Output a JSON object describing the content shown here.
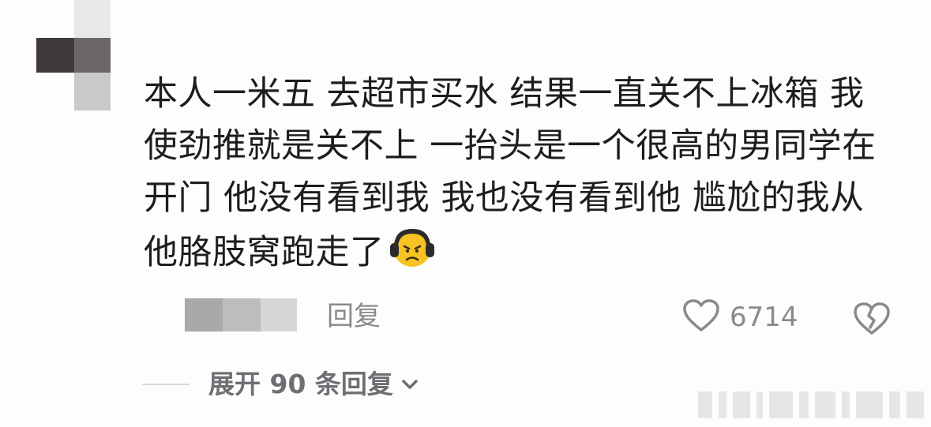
{
  "comment": {
    "lines": [
      "本人一米五 去超市买水 结果一直关不上冰箱 我",
      "使劲推就是关不上 一抬头是一个很高的男同学在",
      "开门 他没有看到我 我也没有看到他 尴尬的我从",
      "他胳肢窝跑走了"
    ],
    "emoji": "grimace-face-emoji"
  },
  "actions": {
    "reply_label": "回复",
    "like_count": "6714",
    "like_icon": "heart-outline-icon",
    "dislike_icon": "broken-heart-icon"
  },
  "replies": {
    "expand_label": "展开 90 条回复",
    "expand_icon": "chevron-down-icon"
  },
  "colors": {
    "background": "#fdfdfd",
    "text": "#1d1d1f",
    "secondary_text": "#8a8a8e",
    "emoji_yellow": "#f7c324"
  }
}
